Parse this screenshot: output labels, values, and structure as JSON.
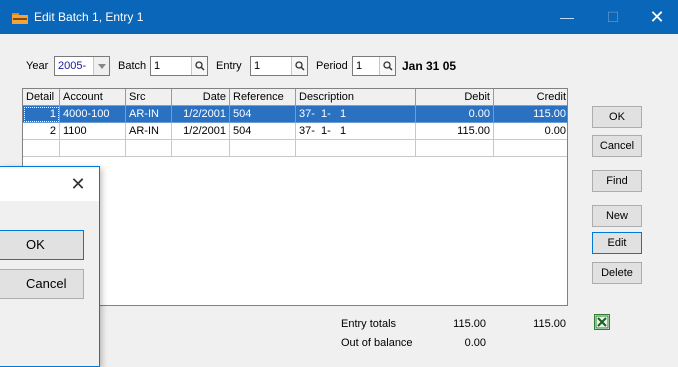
{
  "window": {
    "title": "Edit Batch 1, Entry 1",
    "min_glyph": "—",
    "max_glyph": "☐",
    "close_glyph": "✕",
    "icon": "folder-icon"
  },
  "fields": {
    "year_label": "Year",
    "year_value": "2005-",
    "batch_label": "Batch",
    "batch_value": "1",
    "entry_label": "Entry",
    "entry_value": "1",
    "period_label": "Period",
    "period_value": "1",
    "period_date": "Jan 31 05"
  },
  "grid": {
    "columns": [
      "Detail",
      "Account",
      "Src",
      "Date",
      "Reference",
      "Description",
      "Debit",
      "Credit"
    ],
    "rows": [
      {
        "detail": "1",
        "account": "4000-100",
        "src": "AR-IN",
        "date": "1/2/2001",
        "reference": "504",
        "description": "37-  1-   1",
        "debit": "0.00",
        "credit": "115.00"
      },
      {
        "detail": "2",
        "account": "1100",
        "src": "AR-IN",
        "date": "1/2/2001",
        "reference": "504",
        "description": "37-  1-   1",
        "debit": "115.00",
        "credit": "0.00"
      }
    ]
  },
  "buttons": {
    "ok": "OK",
    "cancel": "Cancel",
    "find": "Find",
    "new": "New",
    "edit": "Edit",
    "delete": "Delete"
  },
  "totals": {
    "entry_totals_label": "Entry totals",
    "entry_totals_debit": "115.00",
    "entry_totals_credit": "115.00",
    "out_of_balance_label": "Out of balance",
    "out_of_balance_value": "0.00"
  },
  "dialog": {
    "close_glyph": "✕",
    "ok": "OK",
    "cancel": "Cancel"
  },
  "colors": {
    "title_bar": "#0a66b8",
    "selection": "#2a71c2",
    "focus_border": "#0078d7"
  }
}
